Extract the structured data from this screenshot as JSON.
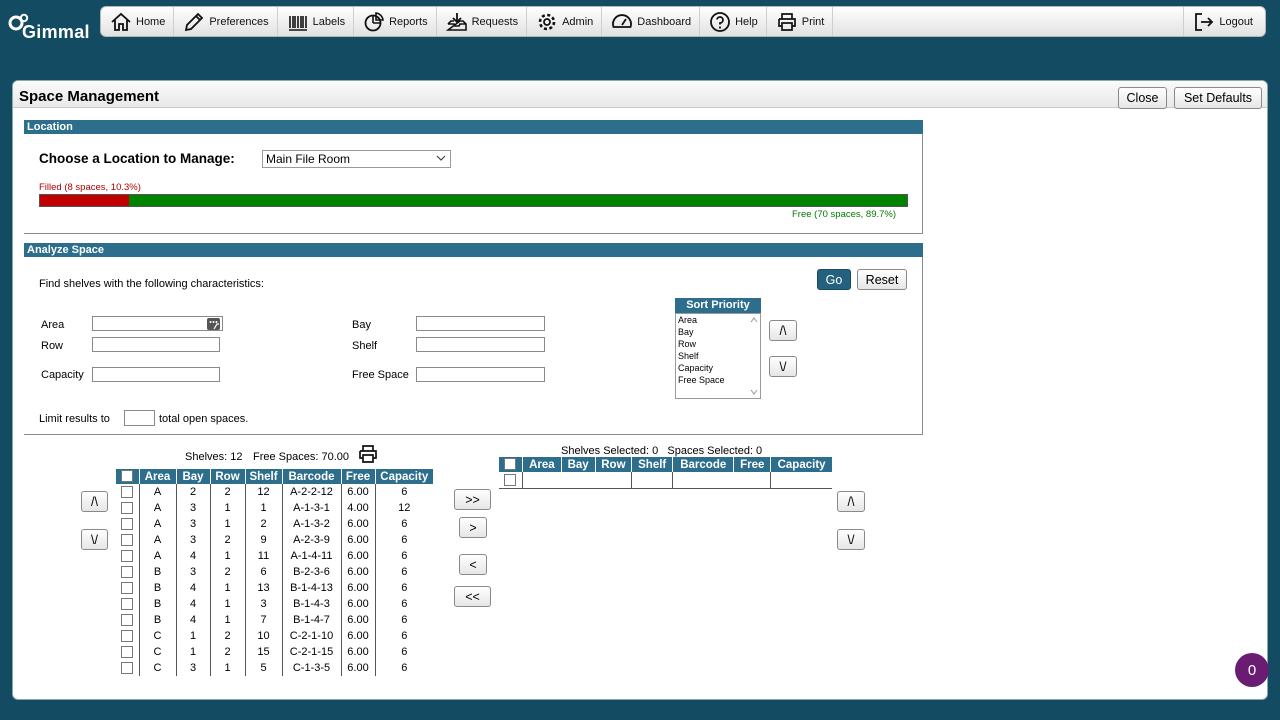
{
  "app": {
    "logo_text": "Gimmal"
  },
  "nav": {
    "items": [
      {
        "label": "Home",
        "icon": "home-icon"
      },
      {
        "label": "Preferences",
        "icon": "pencil-icon"
      },
      {
        "label": "Labels",
        "icon": "barcode-icon"
      },
      {
        "label": "Reports",
        "icon": "pie-chart-icon"
      },
      {
        "label": "Requests",
        "icon": "inbox-icon"
      },
      {
        "label": "Admin",
        "icon": "gear-icon"
      },
      {
        "label": "Dashboard",
        "icon": "gauge-icon"
      },
      {
        "label": "Help",
        "icon": "help-icon"
      },
      {
        "label": "Print",
        "icon": "printer-icon"
      }
    ],
    "logout": "Logout"
  },
  "page": {
    "title": "Space Management",
    "close_label": "Close",
    "defaults_label": "Set Defaults"
  },
  "location": {
    "section_title": "Location",
    "choose_label": "Choose a Location to Manage:",
    "selected": "Main File Room",
    "filled_text": "Filled (8 spaces, 10.3%)",
    "free_text": "Free (70 spaces, 89.7%)",
    "filled_fraction": 0.103,
    "filled_color": "#c00000",
    "free_color": "#008400"
  },
  "analyze": {
    "section_title": "Analyze Space",
    "intro": "Find shelves with the following characteristics:",
    "go_label": "Go",
    "reset_label": "Reset",
    "fields": {
      "area": "Area",
      "row": "Row",
      "capacity": "Capacity",
      "bay": "Bay",
      "shelf": "Shelf",
      "free_space": "Free Space"
    },
    "limit_prefix": "Limit results to",
    "limit_suffix": "total open spaces.",
    "sort_priority_title": "Sort Priority",
    "sort_options": [
      "Area",
      "Bay",
      "Row",
      "Shelf",
      "Capacity",
      "Free Space"
    ],
    "move_up": "/\\",
    "move_down": "\\/"
  },
  "results": {
    "shelves_label": "Shelves: 12",
    "free_label": "Free Spaces: 70.00",
    "columns": [
      "Area",
      "Bay",
      "Row",
      "Shelf",
      "Barcode",
      "Free",
      "Capacity"
    ],
    "rows": [
      [
        "A",
        "2",
        "2",
        "12",
        "A-2-2-12",
        "6.00",
        "6"
      ],
      [
        "A",
        "3",
        "1",
        "1",
        "A-1-3-1",
        "4.00",
        "12"
      ],
      [
        "A",
        "3",
        "1",
        "2",
        "A-1-3-2",
        "6.00",
        "6"
      ],
      [
        "A",
        "3",
        "2",
        "9",
        "A-2-3-9",
        "6.00",
        "6"
      ],
      [
        "A",
        "4",
        "1",
        "11",
        "A-1-4-11",
        "6.00",
        "6"
      ],
      [
        "B",
        "3",
        "2",
        "6",
        "B-2-3-6",
        "6.00",
        "6"
      ],
      [
        "B",
        "4",
        "1",
        "13",
        "B-1-4-13",
        "6.00",
        "6"
      ],
      [
        "B",
        "4",
        "1",
        "3",
        "B-1-4-3",
        "6.00",
        "6"
      ],
      [
        "B",
        "4",
        "1",
        "7",
        "B-1-4-7",
        "6.00",
        "6"
      ],
      [
        "C",
        "1",
        "2",
        "10",
        "C-2-1-10",
        "6.00",
        "6"
      ],
      [
        "C",
        "1",
        "2",
        "15",
        "C-2-1-15",
        "6.00",
        "6"
      ],
      [
        "C",
        "3",
        "1",
        "5",
        "C-1-3-5",
        "6.00",
        "6"
      ]
    ]
  },
  "transfer": {
    "all_right": ">>",
    "one_right": ">",
    "one_left": "<",
    "all_left": "<<"
  },
  "selected": {
    "summary": "Shelves Selected: 0   Spaces Selected: 0",
    "columns": [
      "Area",
      "Bay",
      "Row",
      "Shelf",
      "Barcode",
      "Free",
      "Capacity"
    ]
  },
  "notification_count": "0"
}
